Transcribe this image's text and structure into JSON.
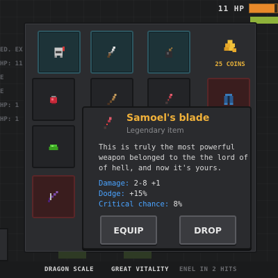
{
  "hud": {
    "hp_label": "11 HP",
    "hp_fraction": 0.9
  },
  "side_labels": [
    "ED. EX",
    "HP: 11",
    "E",
    "E",
    "HP: 1",
    "HP: 1"
  ],
  "inventory": {
    "slots": [
      {
        "icon": "helmet-icon",
        "style": "teal"
      },
      {
        "icon": "dagger-icon",
        "style": "teal"
      },
      {
        "icon": "bomb-icon",
        "style": "teal"
      },
      {
        "icon": "potion-icon",
        "style": "plain"
      },
      {
        "icon": "sword-icon",
        "style": "plain"
      },
      {
        "icon": "blade-icon",
        "style": "plain"
      },
      {
        "icon": "armor-icon",
        "style": "red"
      },
      {
        "icon": "slime-icon",
        "style": "plain"
      },
      {
        "icon": "bow-icon",
        "style": "red"
      }
    ],
    "coins_label": "25 COINS"
  },
  "popup": {
    "item_name": "Samoel's blade",
    "item_rarity": "Legendary item",
    "description": "This is truly the most powerful weapon belonged to the  the lord of of hell, and now it's yours.",
    "stats": [
      {
        "label": "Damage:",
        "value": "2-8 +1"
      },
      {
        "label": "Dodge:",
        "value": "+15%"
      },
      {
        "label": "Critical chance:",
        "value": "8%"
      }
    ],
    "equip_label": "EQUIP",
    "drop_label": "DROP"
  },
  "perks": [
    "DRAGON SCALE",
    "GREAT VITALITY",
    "ENEL IN 2 HITS"
  ],
  "colors": {
    "item_name": "#f0b13a",
    "stat_label": "#4aa3ff",
    "coins": "#e8b23a",
    "hp_fill": "#e8892a"
  }
}
